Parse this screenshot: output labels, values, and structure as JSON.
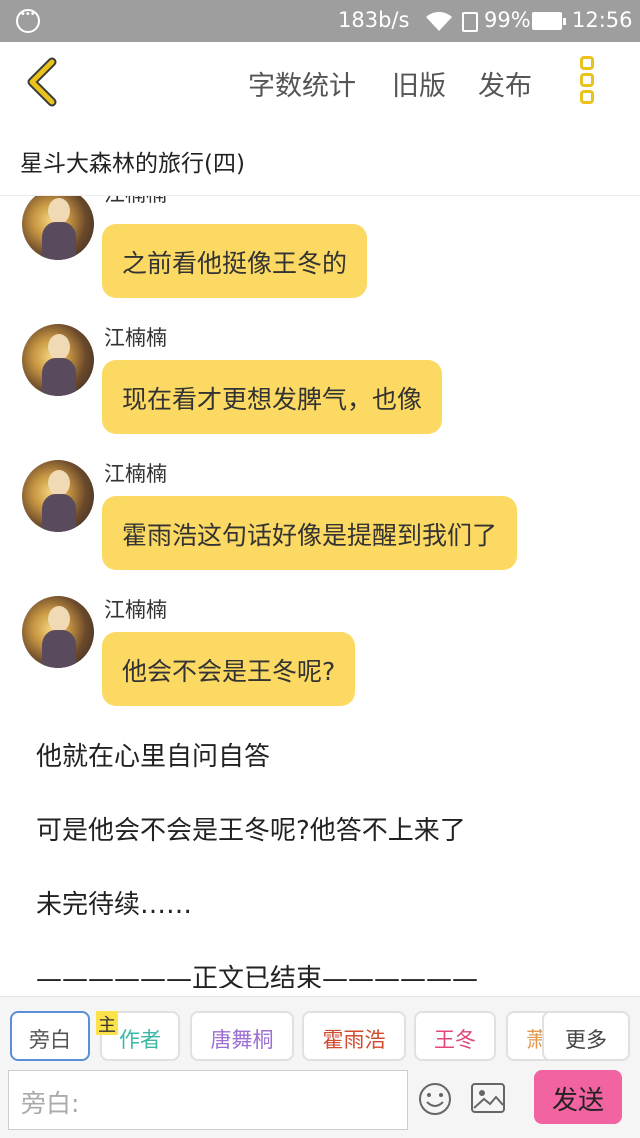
{
  "status": {
    "speed": "183b/s",
    "battery": "99%",
    "time": "12:56"
  },
  "toolbar": {
    "word_count": "字数统计",
    "old_version": "旧版",
    "publish": "发布"
  },
  "chapter_title": "星斗大森林的旅行(四)",
  "messages": [
    {
      "sender": "江楠楠",
      "text": "之前看他挺像王冬的"
    },
    {
      "sender": "江楠楠",
      "text": "现在看才更想发脾气，也像"
    },
    {
      "sender": "江楠楠",
      "text": "霍雨浩这句话好像是提醒到我们了"
    },
    {
      "sender": "江楠楠",
      "text": "他会不会是王冬呢?"
    }
  ],
  "narration": [
    "他就在心里自问自答",
    "可是他会不会是王冬呢?他答不上来了",
    "未完待续……",
    "——————正文已结束——————"
  ],
  "roles": {
    "narrator": "旁白",
    "author": "作者",
    "host_badge": "主",
    "tang": "唐舞桐",
    "huo": "霍雨浩",
    "wang": "王冬",
    "xiao": "萧萧",
    "more": "更多"
  },
  "input": {
    "placeholder": "旁白:",
    "send": "发送"
  },
  "colors": {
    "bubble": "#fbd963",
    "accent_yellow": "#e9c21b",
    "send_button": "#f263a2"
  }
}
